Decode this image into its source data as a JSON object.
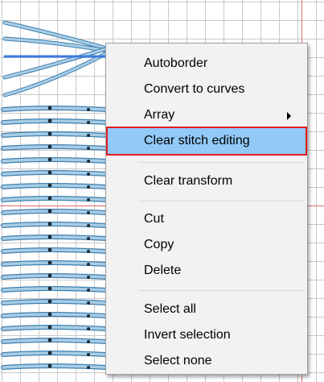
{
  "context_menu": {
    "items": [
      {
        "label": "Autoborder"
      },
      {
        "label": "Convert to curves"
      },
      {
        "label": "Array",
        "submenu_icon": "submenu-arrow-icon"
      },
      {
        "label": "Clear stitch editing",
        "highlighted": true
      },
      {
        "label": "Clear transform"
      },
      {
        "label": "Cut"
      },
      {
        "label": "Copy"
      },
      {
        "label": "Delete"
      },
      {
        "label": "Select all"
      },
      {
        "label": "Invert selection"
      },
      {
        "label": "Select none"
      }
    ]
  },
  "colors": {
    "stitch_light": "#a9cde6",
    "stitch_dark": "#3f7fae",
    "stitch_knot": "#1f2a33",
    "highlight_fill": "#91c9f7",
    "highlight_border": "#e51c23",
    "guide_line": "#e06a6a",
    "selection_line": "#3d7be0"
  }
}
